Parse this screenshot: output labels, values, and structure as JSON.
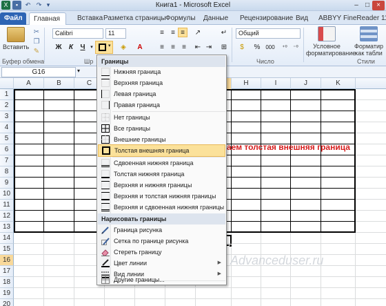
{
  "title_bar": {
    "title": "Книга1  -  Microsoft Excel"
  },
  "tabs": [
    {
      "label": "Файл"
    },
    {
      "label": "Главная"
    },
    {
      "label": "Вставка"
    },
    {
      "label": "Разметка страницы"
    },
    {
      "label": "Формулы"
    },
    {
      "label": "Данные"
    },
    {
      "label": "Рецензирование"
    },
    {
      "label": "Вид"
    },
    {
      "label": "ABBYY FineReader 11"
    }
  ],
  "ribbon": {
    "paste_label": "Вставить",
    "clipboard_label": "Буфер обмена",
    "font_name": "Calibri",
    "font_size": "11",
    "font_group_label": "Шр",
    "number_format": "Общий",
    "number_label": "Число",
    "cond_format_label_1": "Условное",
    "cond_format_label_2": "форматирование",
    "format_table_label_1": "Форматир",
    "format_table_label_2": "как табли",
    "styles_label": "Стили",
    "bold": "Ж",
    "italic": "К",
    "underline": "Ч",
    "percent": "%",
    "thousands": "000"
  },
  "formula_bar": {
    "name_box": "G16"
  },
  "columns": [
    "A",
    "B",
    "C",
    "D",
    "E",
    "F",
    "G",
    "H",
    "I",
    "J",
    "K"
  ],
  "rows": [
    "1",
    "2",
    "3",
    "4",
    "5",
    "6",
    "7",
    "8",
    "9",
    "10",
    "11",
    "12",
    "13",
    "14",
    "15",
    "16",
    "17",
    "18",
    "19",
    "20",
    "21"
  ],
  "selected_row": "16",
  "borders_menu": {
    "header_borders": "Границы",
    "items_top": [
      {
        "label": "Нижняя граница",
        "icon": "bottom-border-icon"
      },
      {
        "label": "Верхняя граница",
        "icon": "top-border-icon"
      },
      {
        "label": "Левая граница",
        "icon": "left-border-icon"
      },
      {
        "label": "Правая граница",
        "icon": "right-border-icon"
      }
    ],
    "items_mid": [
      {
        "label": "Нет границы",
        "icon": "no-border-icon"
      },
      {
        "label": "Все границы",
        "icon": "all-borders-icon"
      },
      {
        "label": "Внешние границы",
        "icon": "outside-borders-icon"
      },
      {
        "label": "Толстая внешняя граница",
        "icon": "thick-box-border-icon",
        "highlighted": true
      }
    ],
    "items_bottom": [
      {
        "label": "Сдвоенная нижняя граница",
        "icon": "double-bottom-border-icon"
      },
      {
        "label": "Толстая нижняя граница",
        "icon": "thick-bottom-border-icon"
      },
      {
        "label": "Верхняя и нижняя границы",
        "icon": "top-bottom-border-icon"
      },
      {
        "label": "Верхняя и толстая нижняя границы",
        "icon": "top-thick-bottom-border-icon"
      },
      {
        "label": "Верхняя и сдвоенная нижняя границы",
        "icon": "top-double-bottom-border-icon"
      }
    ],
    "header_draw": "Нарисовать границы",
    "items_draw": [
      {
        "label": "Граница рисунка",
        "icon": "draw-border-icon"
      },
      {
        "label": "Сетка по границе рисунка",
        "icon": "draw-border-grid-icon"
      },
      {
        "label": "Стереть границу",
        "icon": "erase-border-icon"
      },
      {
        "label": "Цвет линии",
        "icon": "line-color-icon",
        "submenu": true
      },
      {
        "label": "Вид линии",
        "icon": "line-style-icon",
        "submenu": true
      }
    ],
    "more_borders": "Другие границы..."
  },
  "annotation": "Выбираем толстая внешняя граница",
  "watermark": "Advanceduser.ru",
  "colors": {
    "file_tab": "#2d64b4",
    "highlight": "#fbe19a",
    "annotation": "#d61c1c"
  }
}
